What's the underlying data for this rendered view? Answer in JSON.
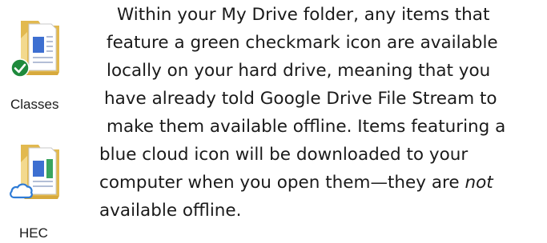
{
  "folders": [
    {
      "label": "Classes",
      "status": "green-checkmark",
      "status_color": "#1e8a3c"
    },
    {
      "label": "HEC",
      "status": "blue-cloud",
      "status_color": "#2e7bd6"
    }
  ],
  "colors": {
    "folder_tan": "#e8c46a",
    "folder_light": "#f6e2a6",
    "doc_blue": "#3d6fd1",
    "doc_green": "#3aa55f",
    "text": "#1a1a1a"
  },
  "paragraph": {
    "lines": [
      "Within your My Drive folder, any items that",
      "feature a green checkmark icon are available",
      "locally on your hard drive, meaning that you",
      "have already told Google Drive File Stream to",
      "make them available offline. Items featuring a",
      "blue cloud icon will be downloaded to your",
      "computer when you open them—they are ",
      "available offline."
    ],
    "emphasis": "not"
  }
}
